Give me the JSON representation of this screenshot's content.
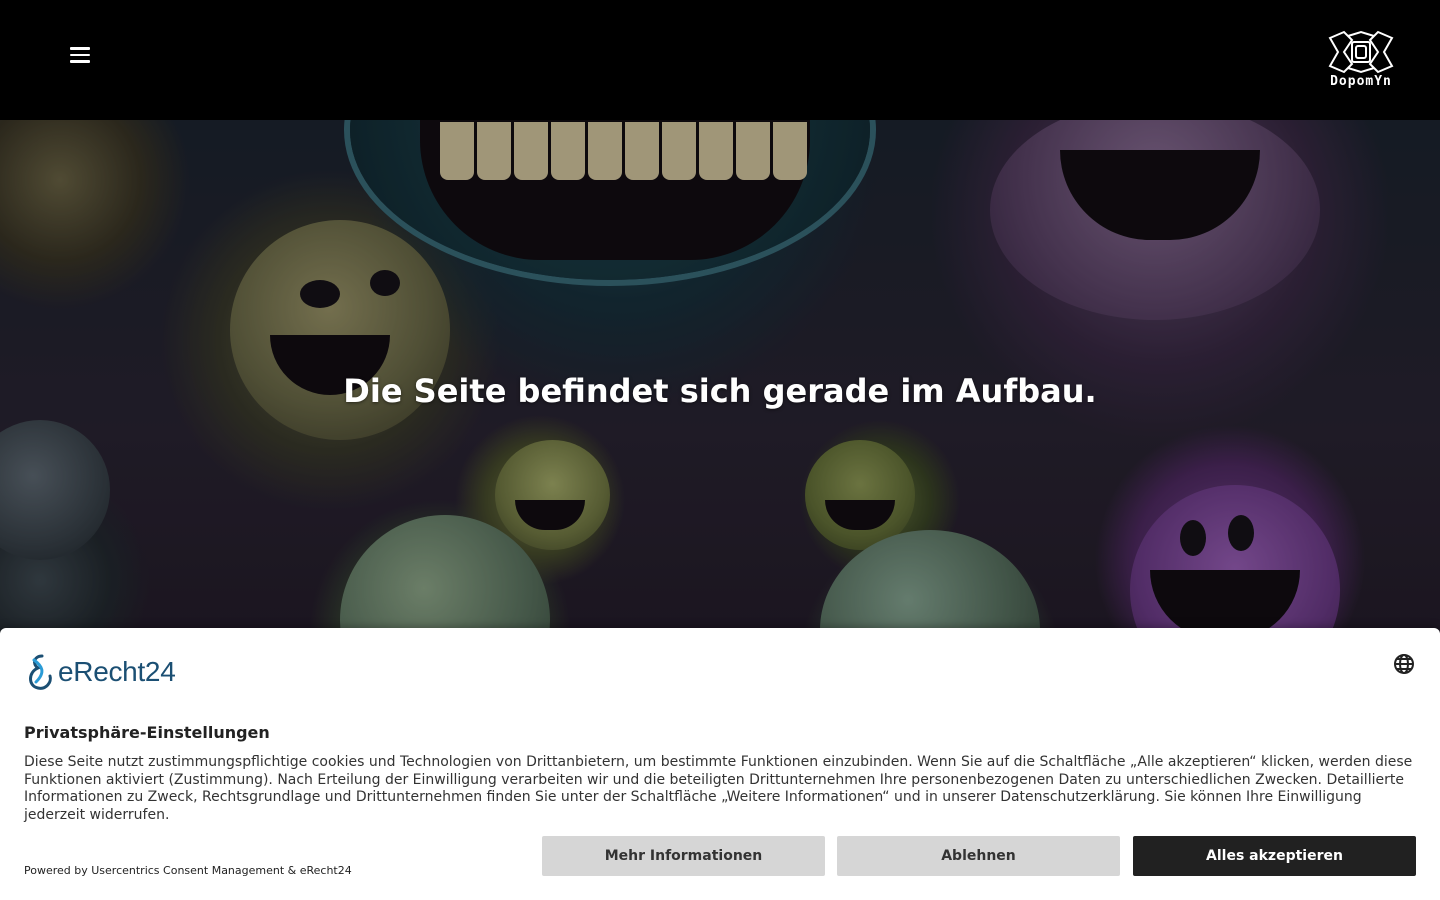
{
  "header": {
    "logo_text": "DopomYn"
  },
  "hero": {
    "title": "Die Seite befindet sich gerade im Aufbau."
  },
  "consent": {
    "brand": "eRecht24",
    "title": "Privatsphäre-Einstellungen",
    "body": "Diese Seite nutzt zustimmungspflichtige cookies und Technologien von Drittanbietern, um bestimmte Funktionen einzubinden. Wenn Sie auf die Schaltfläche „Alle akzeptieren“ klicken, werden diese Funktionen aktiviert (Zustimmung). Nach Erteilung der Einwilligung verarbeiten wir und die beteiligten Drittunternehmen Ihre personenbezogenen Daten zu unterschiedlichen Zwecken. Detaillierte Informationen zu Zweck, Rechtsgrundlage und Drittunternehmen finden Sie unter der Schaltfläche „Weitere Informationen“ und in unserer Datenschutzerklärung. Sie können Ihre Einwilligung jederzeit widerrufen.",
    "powered_by": "Powered by Usercentrics Consent Management & eRecht24",
    "buttons": {
      "more": "Mehr Informationen",
      "decline": "Ablehnen",
      "accept": "Alles akzeptieren"
    }
  },
  "icons": {
    "menu": "hamburger-menu-icon",
    "language": "globe-icon"
  },
  "colors": {
    "header_bg": "#000000",
    "accept_bg": "#212121",
    "secondary_bg": "#d6d6d6",
    "brand_blue": "#1b4f73"
  }
}
